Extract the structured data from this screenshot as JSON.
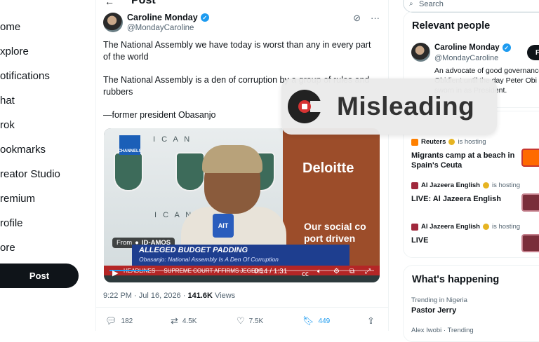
{
  "nav": {
    "items": [
      "ome",
      "xplore",
      "otifications",
      "hat",
      "rok",
      "ookmarks",
      "reator Studio",
      "remium",
      "rofile",
      "ore"
    ],
    "post_label": "Post"
  },
  "main": {
    "header_title": "Post",
    "author": {
      "name": "Caroline Monday",
      "handle": "@MondayCaroline"
    },
    "tweet": {
      "p1": "The National Assembly we have today is worst than any in every part of the world",
      "p2": "The National Assembly is a den of corruption by a group of rules and rubbers",
      "p3": "—former president Obasanjo"
    },
    "video": {
      "deloitte": "Deloitte",
      "social": "Our social co\nport driven\nof Nigeria",
      "ican": "I C A N",
      "mic_label": "AIT",
      "channel": "CHANNELS",
      "from_label": "From",
      "from_source": "ID-AMOS",
      "lower_title": "ALLEGED BUDGET PADDING",
      "lower_sub": "Obasanjo: National Assembly Is A Den Of Corruption",
      "ticker_1": "HEADLINES",
      "ticker_2": "SUPREME COURT AFFIRMS JEGEDE",
      "time": "0:14 / 1:31",
      "progress": 0.15
    },
    "meta": {
      "timestamp": "9:22 PM · Jul 16, 2026 · ",
      "views_count": "141.6K",
      "views_label": " Views"
    },
    "actions": {
      "replies": "182",
      "reposts": "4.5K",
      "likes": "7.5K",
      "bookmarks": "449"
    }
  },
  "right": {
    "search_placeholder": "Search",
    "relevant": {
      "title": "Relevant people",
      "name": "Caroline Monday",
      "handle": "@MondayCaroline",
      "bio": "An advocate of good governance. Obidient until the day Peter Obi is sworn in as President.",
      "follow": "F"
    },
    "live": [
      {
        "host": "Reuters",
        "suffix": "is hosting",
        "title": "Migrants camp at a beach in Spain's Ceuta",
        "color": "#ff8000"
      },
      {
        "host": "Al Jazeera English",
        "suffix": "is hosting",
        "title": "LIVE: Al Jazeera English",
        "color": "#a0283c"
      },
      {
        "host": "Al Jazeera English",
        "suffix": "is hosting",
        "title": "LIVE",
        "color": "#a0283c"
      }
    ],
    "happening": {
      "title": "What's happening",
      "t1_ctx": "Trending in Nigeria",
      "t1_title": "Pastor Jerry",
      "t2_ctx": "Alex Iwobi · Trending"
    }
  },
  "overlay": {
    "label": "Misleading"
  },
  "colors": {
    "accent": "#1d9bf0",
    "text": "#0f1419",
    "muted": "#536471",
    "bookmark": "#1d9bf0"
  }
}
